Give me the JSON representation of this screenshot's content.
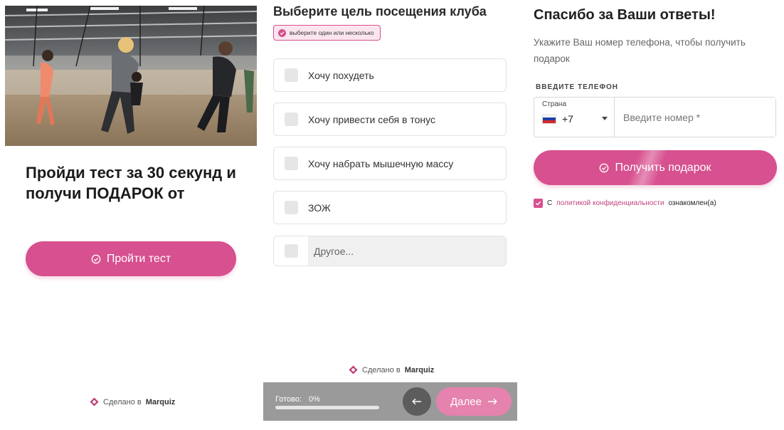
{
  "colors": {
    "accent": "#d7508f",
    "accent_light": "#e582ad",
    "bar": "#9a9a9a"
  },
  "panel1": {
    "hero_image": "fitness-class-trx-photo",
    "title": "Пройди тест за 30 секунд и получи ПОДАРОК от",
    "start_button": "Пройти тест",
    "made_by_prefix": "Сделано в",
    "made_by_brand": "Marquiz"
  },
  "panel2": {
    "question": "Выберите цель посещения клуба",
    "hint": "выберите один или несколько",
    "options": [
      {
        "label": "Хочу похудеть",
        "checked": false
      },
      {
        "label": "Хочу привести себя в тонус",
        "checked": false
      },
      {
        "label": "Хочу набрать мышечную массу",
        "checked": false
      },
      {
        "label": "ЗОЖ",
        "checked": false
      }
    ],
    "other_placeholder": "Другое...",
    "made_by_prefix": "Сделано в",
    "made_by_brand": "Marquiz",
    "progress_label": "Готово:",
    "progress_value": "0%",
    "progress_fraction": 0,
    "next_button": "Далее"
  },
  "panel3": {
    "title": "Спасибо за Ваши ответы!",
    "subtitle": "Укажите Ваш номер телефона, чтобы получить подарок",
    "phone_label": "ВВЕДИТЕ ТЕЛЕФОН",
    "country_label": "Страна",
    "country_code": "+7",
    "phone_placeholder": "Введите номер *",
    "gift_button": "Получить подарок",
    "consent_prefix": "С",
    "consent_link": "политикой конфиденциальности",
    "consent_suffix": "ознакомлен(а)",
    "consent_checked": true
  }
}
